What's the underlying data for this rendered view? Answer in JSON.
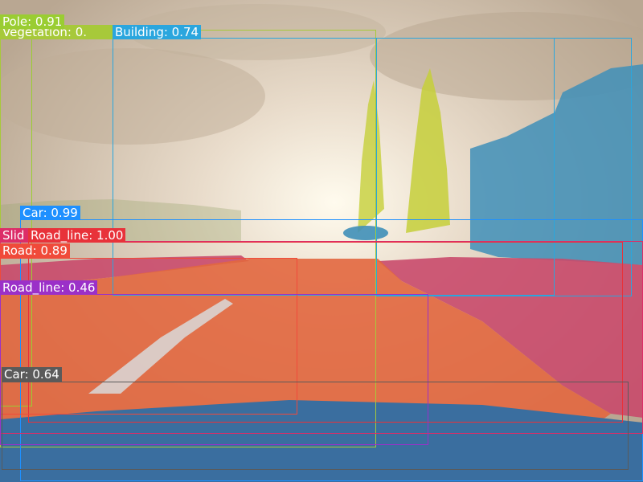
{
  "detections": [
    {
      "id": "pole",
      "text": "Pole: 0.91",
      "color": "#9acd32"
    },
    {
      "id": "vegetation",
      "text": "Vegetation: 0.",
      "color": "#a7c93a"
    },
    {
      "id": "building",
      "text": "Building: 0.74",
      "color": "#2aa6de"
    },
    {
      "id": "car-1",
      "text": "Car: 0.99",
      "color": "#1e90ff"
    },
    {
      "id": "sidewalk",
      "text": "Slid",
      "color": "#dc2d68"
    },
    {
      "id": "road-line-1",
      "text": "Road_line: 1.00",
      "color": "#e8323a"
    },
    {
      "id": "road",
      "text": "Road: 0.89",
      "color": "#f04a3a"
    },
    {
      "id": "road-line-2",
      "text": "Road_line: 0.46",
      "color": "#9b30c8"
    },
    {
      "id": "car-2",
      "text": "Car: 0.64",
      "color": "#5a5a5a"
    }
  ],
  "segmentation": {
    "sky": "#cdb9a0",
    "road": "#e2673f",
    "sidewalk": "#c94a6c",
    "building": "#3f8fb8",
    "vegetation": "#c6cf3a",
    "road_line": "#d9d9d9",
    "car": "#3a6e9f"
  }
}
